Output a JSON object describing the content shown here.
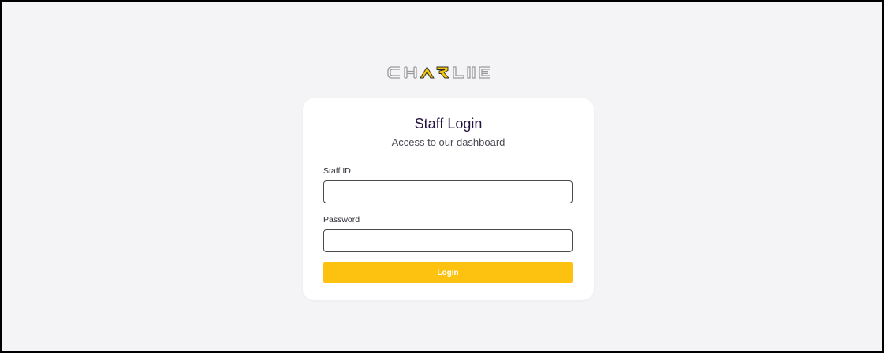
{
  "brand": {
    "logo_text": "CHARLIE",
    "colors": {
      "letters": "#9a9a9a",
      "accent": "#f2c40f",
      "accent_outline": "#2b2b2b"
    }
  },
  "login_card": {
    "title": "Staff Login",
    "subtitle": "Access to our dashboard",
    "fields": {
      "staff_id": {
        "label": "Staff ID",
        "value": "",
        "placeholder": ""
      },
      "password": {
        "label": "Password",
        "value": "",
        "placeholder": ""
      }
    },
    "submit_label": "Login"
  },
  "colors": {
    "page_background": "#f4f4f6",
    "card_background": "#ffffff",
    "title_text": "#26133f",
    "button_background": "#fdc20f",
    "button_text": "#ffffff"
  }
}
